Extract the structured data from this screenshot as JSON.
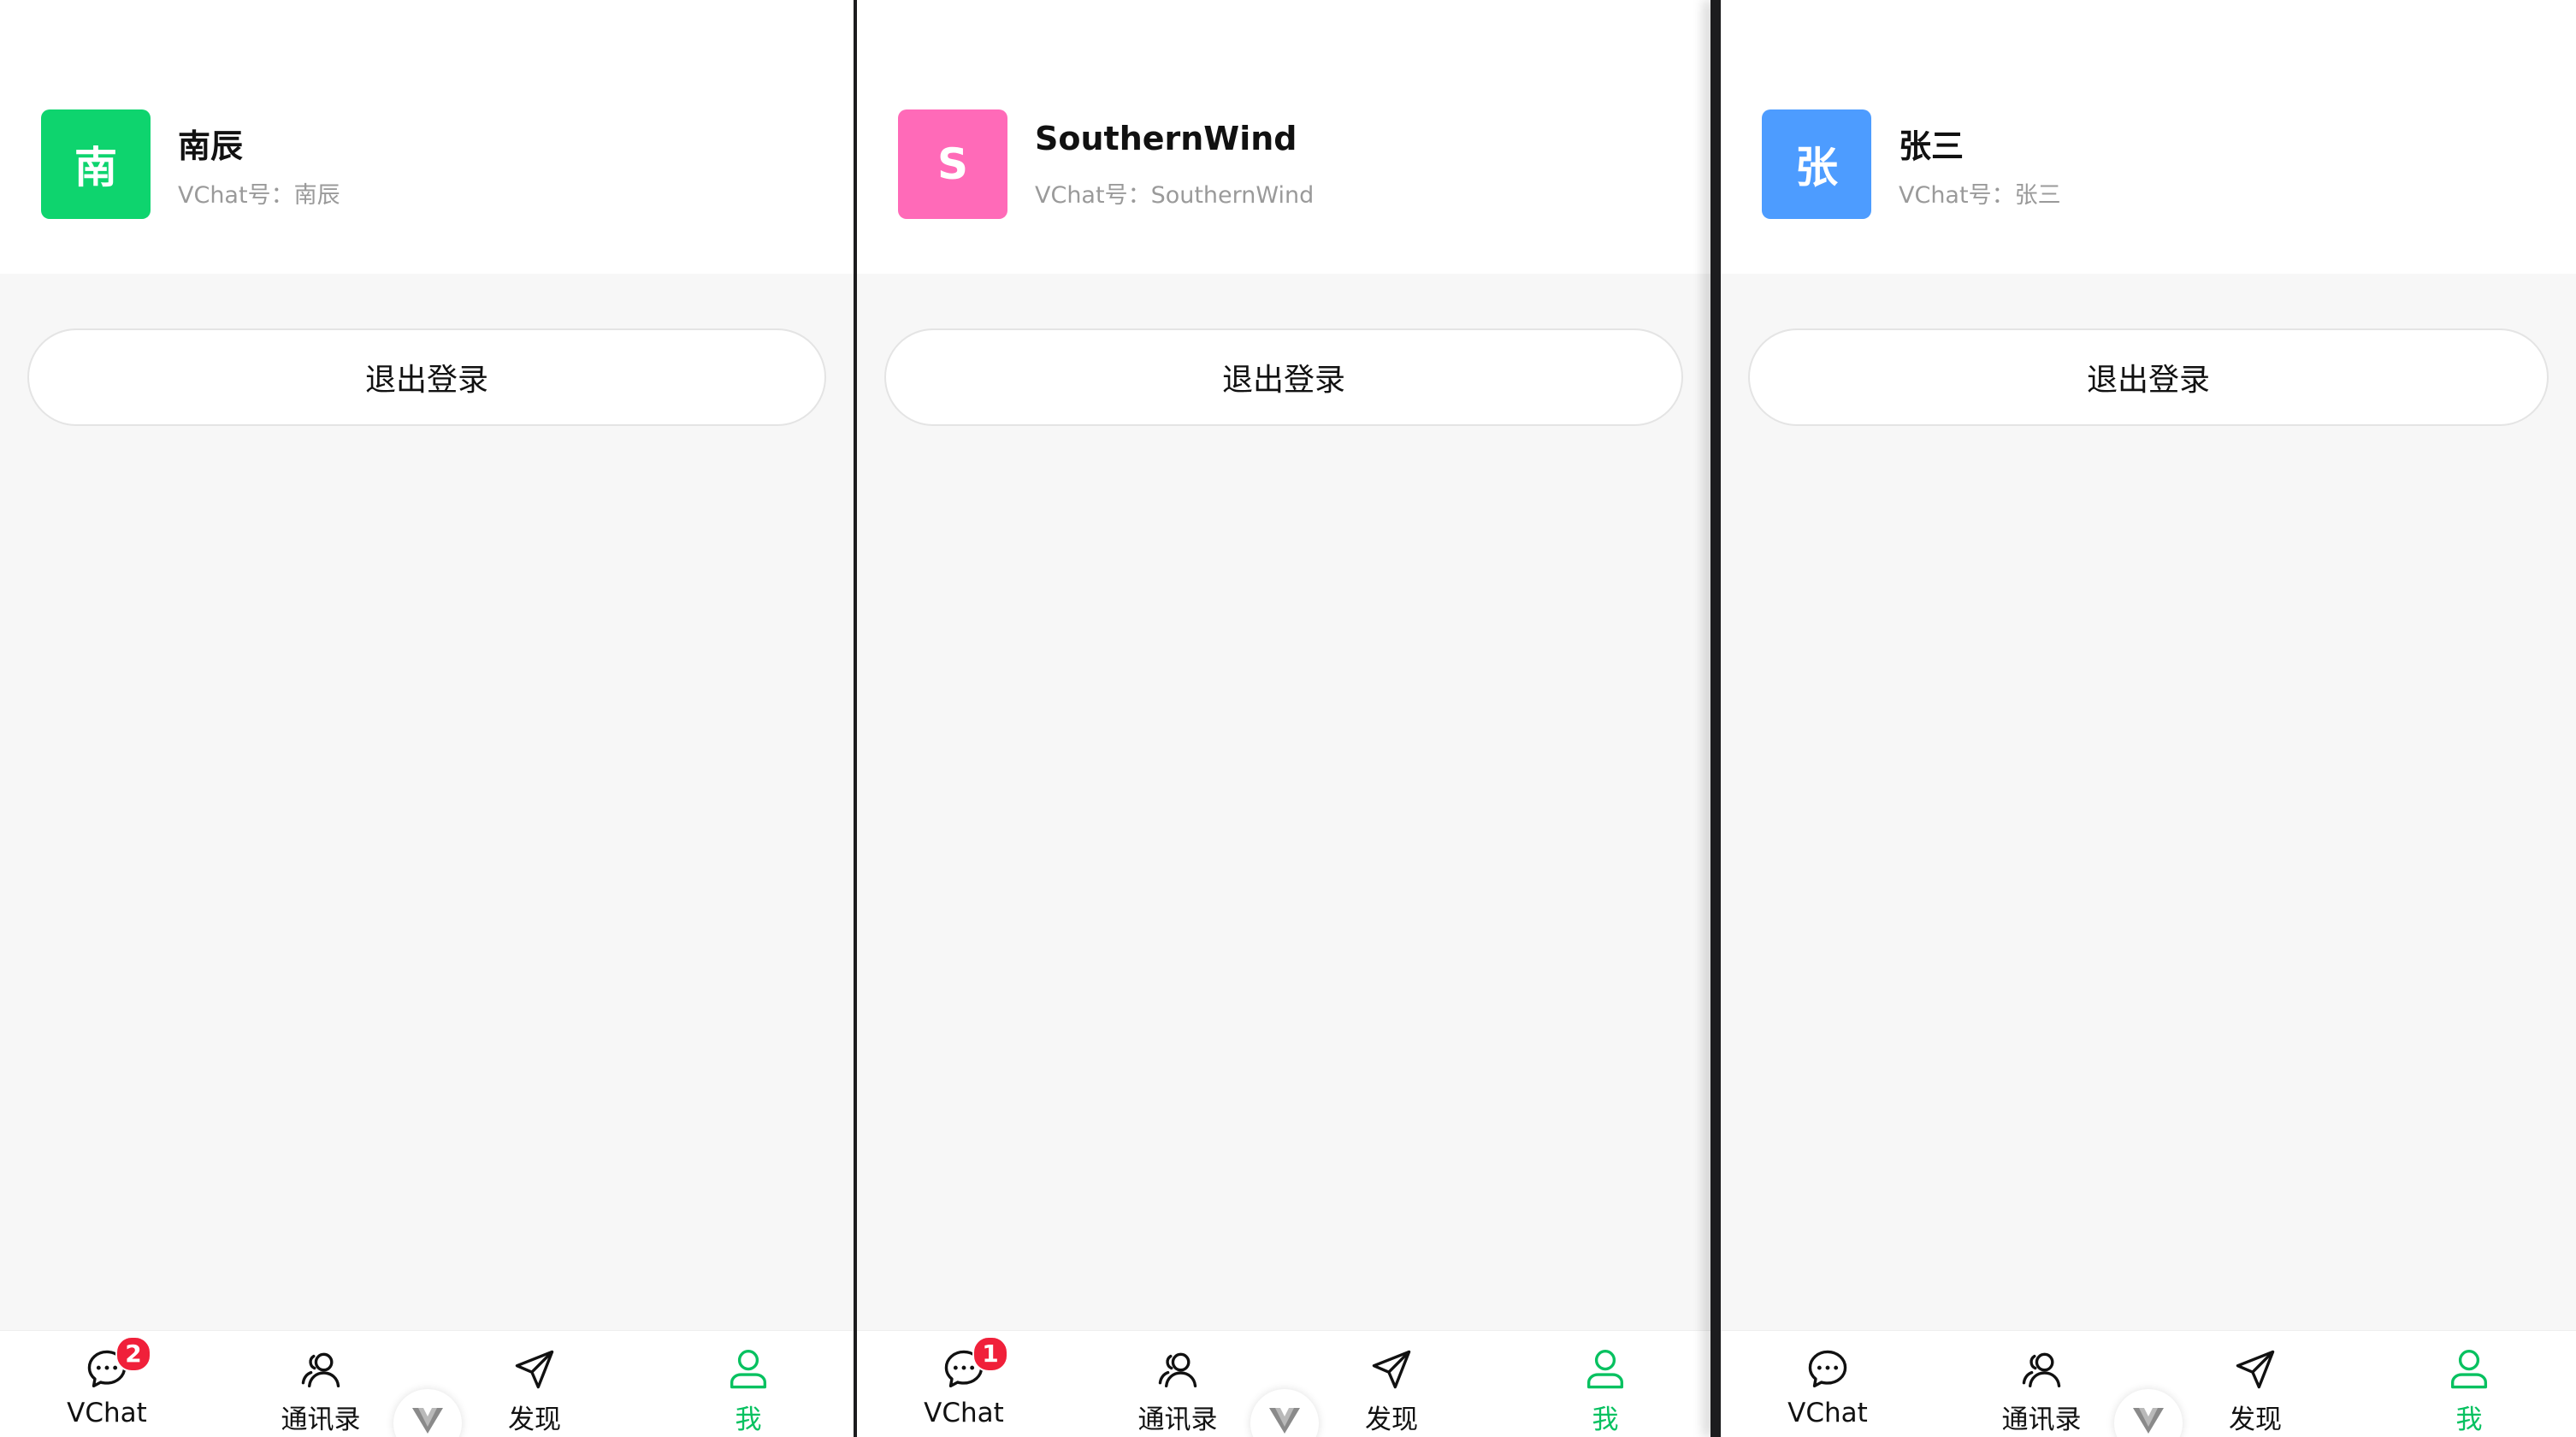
{
  "colors": {
    "accent": "#07c160",
    "badge": "#f0203a",
    "avatar_green": "#0ed46e",
    "avatar_pink": "#ff6ab8",
    "avatar_blue": "#4d9cff"
  },
  "panels": [
    {
      "avatar_char": "南",
      "avatar_color": "#0ed46e",
      "name": "南辰",
      "vchat_id": "VChat号：南辰",
      "logout_label": "退出登录",
      "tabs": [
        {
          "label": "VChat",
          "icon": "chat-icon",
          "badge": "2"
        },
        {
          "label": "通讯录",
          "icon": "contacts-icon"
        },
        {
          "label": "发现",
          "icon": "discover-icon"
        },
        {
          "label": "我",
          "icon": "me-icon",
          "active": true
        }
      ]
    },
    {
      "avatar_char": "S",
      "avatar_color": "#ff6ab8",
      "name": "SouthernWind",
      "vchat_id": "VChat号：SouthernWind",
      "logout_label": "退出登录",
      "tabs": [
        {
          "label": "VChat",
          "icon": "chat-icon",
          "badge": "1"
        },
        {
          "label": "通讯录",
          "icon": "contacts-icon"
        },
        {
          "label": "发现",
          "icon": "discover-icon"
        },
        {
          "label": "我",
          "icon": "me-icon",
          "active": true
        }
      ]
    },
    {
      "avatar_char": "张",
      "avatar_color": "#4d9cff",
      "name": "张三",
      "vchat_id": "VChat号：张三",
      "logout_label": "退出登录",
      "tabs": [
        {
          "label": "VChat",
          "icon": "chat-icon"
        },
        {
          "label": "通讯录",
          "icon": "contacts-icon"
        },
        {
          "label": "发现",
          "icon": "discover-icon"
        },
        {
          "label": "我",
          "icon": "me-icon",
          "active": true
        }
      ]
    }
  ]
}
